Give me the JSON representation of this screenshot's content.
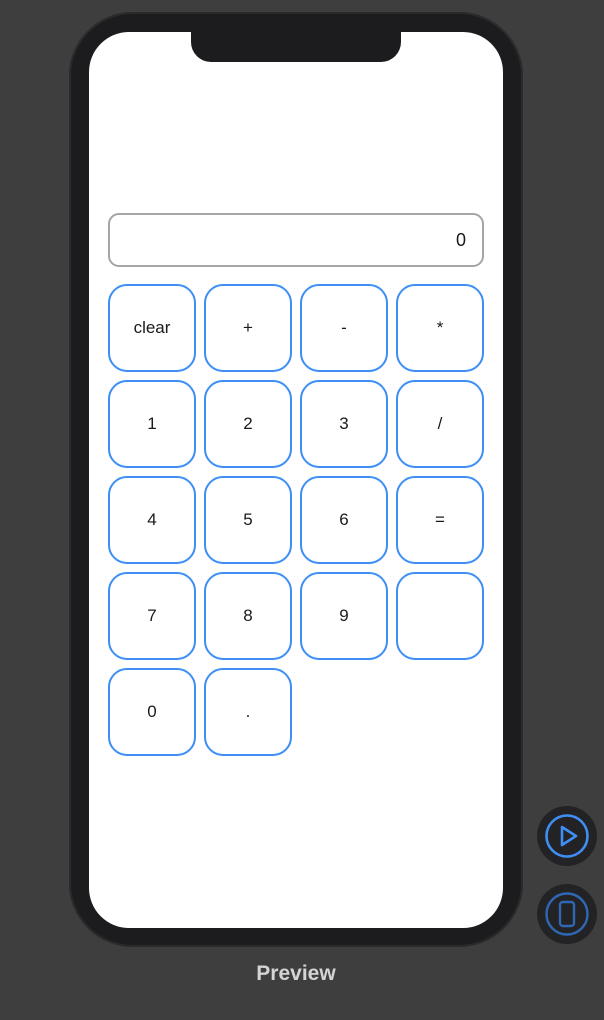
{
  "display": {
    "value": "0"
  },
  "keypad": {
    "keys": [
      "clear",
      "+",
      "-",
      "*",
      "1",
      "2",
      "3",
      "/",
      "4",
      "5",
      "6",
      "=",
      "7",
      "8",
      "9",
      "",
      "0",
      "."
    ]
  },
  "preview": {
    "label": "Preview"
  },
  "controls": {
    "play_icon": "play-icon",
    "device_icon": "device-icon",
    "accent_color": "#3f8ef5"
  }
}
